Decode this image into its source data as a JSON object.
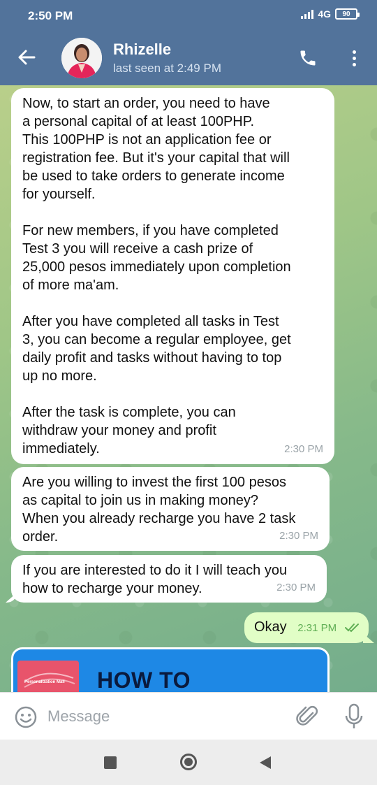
{
  "status_bar": {
    "time": "2:50 PM",
    "network": "4G",
    "battery": "90",
    "icons": [
      "signal-icon",
      "battery-icon"
    ]
  },
  "header": {
    "name": "Rhizelle",
    "last_seen": "last seen at 2:49 PM",
    "icons": [
      "back-arrow-icon",
      "phone-icon",
      "more-vert-icon"
    ],
    "accent": "#52739b"
  },
  "messages": [
    {
      "direction": "incoming",
      "text": "Now, to start an order, you need to have\na personal capital of at least 100PHP.\nThis 100PHP is not an application fee or\nregistration fee. But it's your capital that will\nbe used to take orders to generate income\nfor yourself.\n\nFor new members, if you have completed\nTest 3 you will receive a cash prize of\n25,000 pesos immediately upon completion\nof more ma'am.\n\nAfter you have completed all tasks in Test\n3, you can become a regular employee, get\ndaily profit and tasks without having to top\nup no more.\n\nAfter the task is complete, you can\nwithdraw your money and profit\nimmediately.",
      "time": "2:30 PM"
    },
    {
      "direction": "incoming",
      "text": "Are you willing to invest the first 100 pesos\nas capital to join us in making money?\nWhen you already recharge you have 2 task\norder.",
      "time": "2:30 PM"
    },
    {
      "direction": "incoming",
      "text": "If you are interested to do it I will teach you\nhow to recharge your money.",
      "time": "2:30 PM"
    },
    {
      "direction": "outgoing",
      "text": "Okay",
      "time": "2:31 PM",
      "status_icon": "double-check-icon"
    }
  ],
  "media_card": {
    "title": "HOW TO RECHARGE",
    "thumb_label": "Personalization Mall"
  },
  "input_bar": {
    "placeholder": "Message",
    "icons": [
      "emoji-icon",
      "attach-icon",
      "mic-icon"
    ]
  },
  "nav_bar": {
    "icons": [
      "recents-square-icon",
      "home-circle-icon",
      "back-triangle-icon"
    ]
  },
  "colors": {
    "header": "#52739b",
    "incoming_bubble": "#ffffff",
    "outgoing_bubble": "#e1fec6",
    "read_check": "#5fae54"
  }
}
